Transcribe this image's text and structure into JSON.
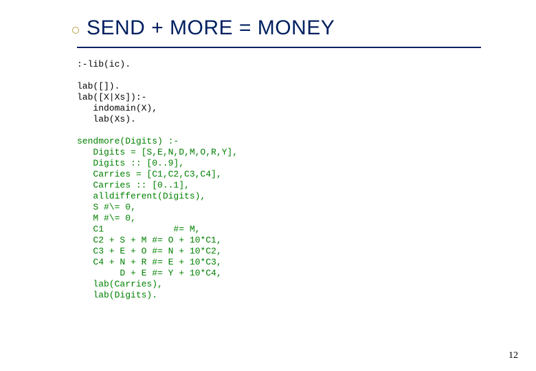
{
  "title": "SEND + MORE = MONEY",
  "code": {
    "line1": ":-lib(ic).",
    "blank1": "",
    "line2": "lab([]).",
    "line3": "lab([X|Xs]):-",
    "line4": "   indomain(X),",
    "line5": "   lab(Xs).",
    "blank2": "",
    "g1": "sendmore(Digits) :-",
    "g2": "   Digits = [S,E,N,D,M,O,R,Y],",
    "g3": "   Digits :: [0..9],",
    "g4": "   Carries = [C1,C2,C3,C4],",
    "g5": "   Carries :: [0..1],",
    "g6": "   alldifferent(Digits),",
    "g7": "   S #\\= 0,",
    "g8": "   M #\\= 0,",
    "g9": "   C1             #= M,",
    "g10": "   C2 + S + M #= O + 10*C1,",
    "g11": "   C3 + E + O #= N + 10*C2,",
    "g12": "   C4 + N + R #= E + 10*C3,",
    "g13": "        D + E #= Y + 10*C4,",
    "g14": "   lab(Carries),",
    "g15": "   lab(Digits)."
  },
  "page_number": "12"
}
